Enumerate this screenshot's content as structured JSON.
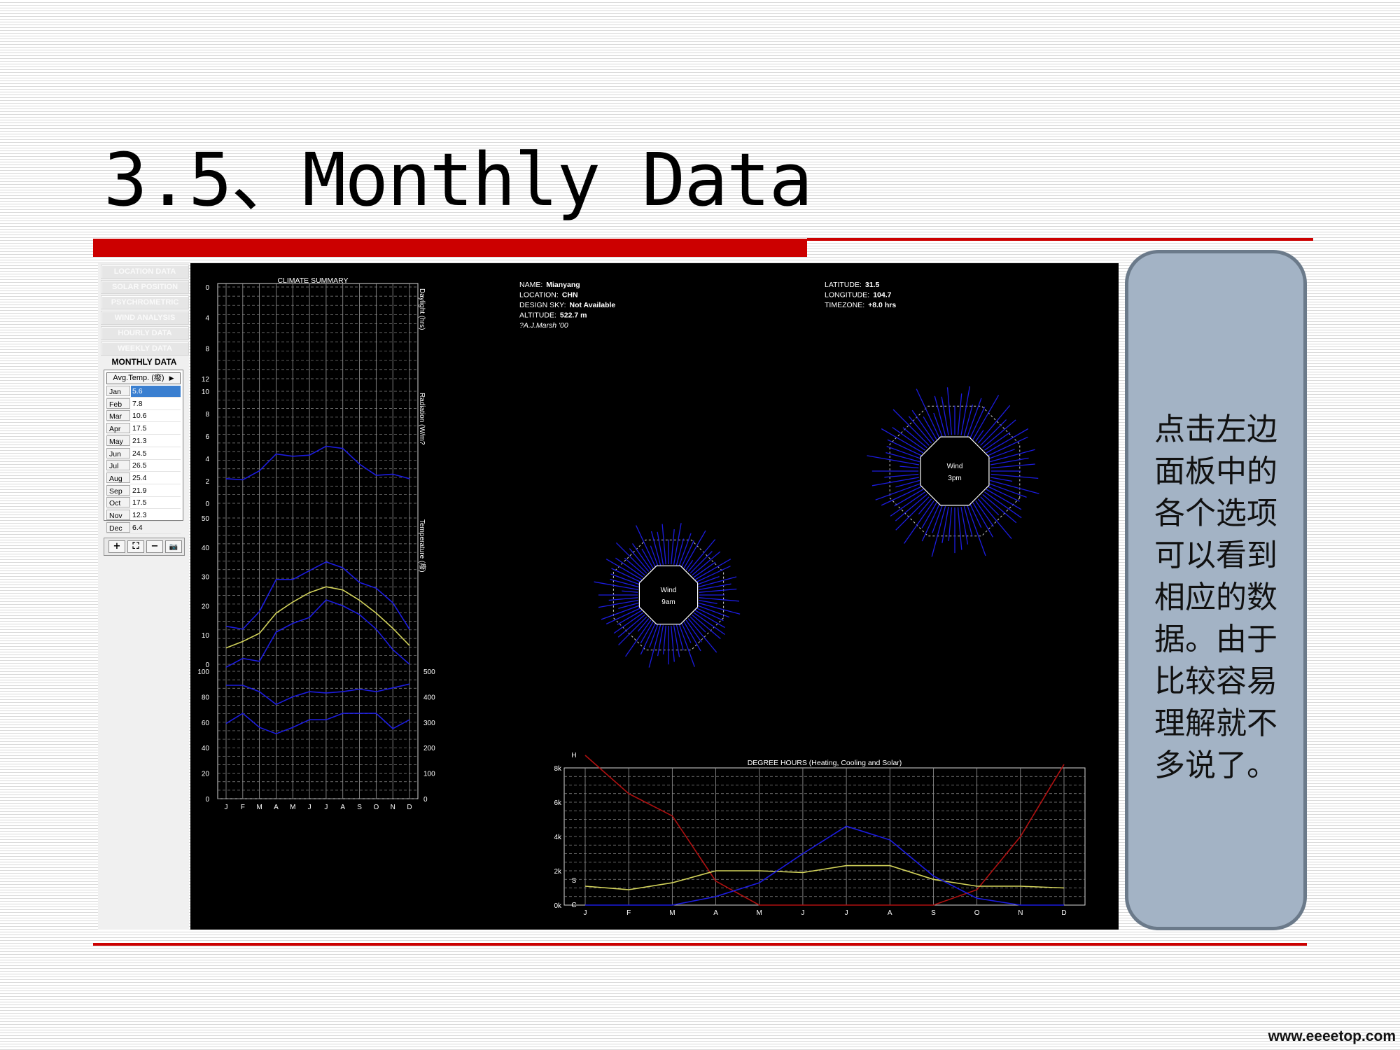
{
  "slide": {
    "title": "3.5、Monthly Data",
    "callout": "点击左边面板中的各个选项可以看到相应的数据。由于比较容易理解就不多说了。",
    "watermark": "www.eeeetop.com"
  },
  "colors": {
    "accent_red": "#cc0000",
    "callout_fill": "#a3b3c5",
    "callout_border": "#6b7a8a",
    "canvas_bg": "#000000",
    "series_blue": "#1c1ce0",
    "series_yellow": "#d2d25a",
    "series_red": "#b01010",
    "selected_row": "#3a7fd0"
  },
  "panel": {
    "menu": [
      "LOCATION DATA",
      "SOLAR POSITION",
      "PSYCHROMETRIC",
      "WIND ANALYSIS",
      "HOURLY DATA",
      "WEEKLY DATA"
    ],
    "heading": "MONTHLY DATA",
    "selector": "Avg.Temp. (癈)",
    "selector_icon": "triangle-right-icon",
    "rows": [
      {
        "month": "Jan",
        "value": "5.6"
      },
      {
        "month": "Feb",
        "value": "7.8"
      },
      {
        "month": "Mar",
        "value": "10.6"
      },
      {
        "month": "Apr",
        "value": "17.5"
      },
      {
        "month": "May",
        "value": "21.3"
      },
      {
        "month": "Jun",
        "value": "24.5"
      },
      {
        "month": "Jul",
        "value": "26.5"
      },
      {
        "month": "Aug",
        "value": "25.4"
      },
      {
        "month": "Sep",
        "value": "21.9"
      },
      {
        "month": "Oct",
        "value": "17.5"
      },
      {
        "month": "Nov",
        "value": "12.3"
      },
      {
        "month": "Dec",
        "value": "6.4"
      }
    ],
    "selected_row": 0,
    "tools": [
      {
        "glyph": "+",
        "icon": "zoom-in-icon"
      },
      {
        "glyph": "⛶",
        "icon": "fit-to-window-icon"
      },
      {
        "glyph": "−",
        "icon": "zoom-out-icon"
      },
      {
        "glyph": "📷",
        "icon": "camera-icon"
      }
    ]
  },
  "info": {
    "left": [
      {
        "label": "NAME:",
        "value": "Mianyang"
      },
      {
        "label": "LOCATION:",
        "value": "CHN"
      },
      {
        "label": "DESIGN SKY:",
        "value": "Not Available"
      },
      {
        "label": "ALTITUDE:",
        "value": "522.7 m"
      }
    ],
    "credit": "?A.J.Marsh '00",
    "right": [
      {
        "label": "LATITUDE:",
        "value": "31.5"
      },
      {
        "label": "LONGITUDE:",
        "value": "104.7"
      },
      {
        "label": "TIMEZONE:",
        "value": "+8.0 hrs"
      }
    ]
  },
  "wind_roses": [
    {
      "name": "wind-rose-9am",
      "line1": "Wind",
      "line2": "9am"
    },
    {
      "name": "wind-rose-3pm",
      "line1": "Wind",
      "line2": "3pm"
    }
  ],
  "chart_data": [
    {
      "type": "line",
      "title": "CLIMATE SUMMARY",
      "categories": [
        "J",
        "F",
        "M",
        "A",
        "M",
        "J",
        "J",
        "A",
        "S",
        "O",
        "N",
        "D"
      ],
      "panels": [
        {
          "id": "daylight",
          "ylabel": "Daylight (hrs)",
          "ylim": [
            0,
            12
          ],
          "yticks": [
            "0",
            "4",
            "8",
            "12"
          ],
          "inverted": true,
          "series": []
        },
        {
          "id": "radiation",
          "ylabel": "Radiation (W/m?",
          "ylim": [
            0,
            10
          ],
          "yticks": [
            "10",
            "8",
            "6",
            "4",
            "2",
            "0"
          ],
          "series": [
            {
              "color": "#1c1ce0",
              "values": [
                2.2,
                2.1,
                2.9,
                4.4,
                4.2,
                4.3,
                5.1,
                4.9,
                3.5,
                2.5,
                2.6,
                2.2
              ]
            }
          ]
        },
        {
          "id": "temperature",
          "ylabel": "Temperature (癈)",
          "ylim": [
            0,
            50
          ],
          "yticks": [
            "50",
            "40",
            "30",
            "20",
            "10",
            "0"
          ],
          "series": [
            {
              "color": "#1c1ce0",
              "values": [
                13,
                12,
                18,
                29,
                29,
                32,
                35,
                33,
                28,
                26,
                21,
                12
              ]
            },
            {
              "color": "#d2d25a",
              "values": [
                5.6,
                7.8,
                10.6,
                17.5,
                21.3,
                24.5,
                26.5,
                25.4,
                21.9,
                17.5,
                12.3,
                6.4
              ]
            },
            {
              "color": "#1c1ce0",
              "values": [
                -1,
                2,
                1,
                11,
                14,
                16,
                22,
                20,
                17,
                12,
                5,
                0
              ]
            }
          ]
        },
        {
          "id": "humidity-rain",
          "ylabel": "",
          "ylim": [
            0,
            100
          ],
          "yticks": [
            "100",
            "80",
            "60",
            "40",
            "20",
            "0"
          ],
          "ylim_right": [
            0,
            500
          ],
          "yticks_right": [
            "500",
            "400",
            "300",
            "200",
            "100",
            "0"
          ],
          "series": [
            {
              "color": "#1c1ce0",
              "values": [
                89,
                89,
                84,
                74,
                80,
                84,
                83,
                84,
                86,
                84,
                87,
                90
              ]
            },
            {
              "color": "#1c1ce0",
              "values": [
                59,
                67,
                56,
                51,
                56,
                62,
                62,
                67,
                67,
                67,
                55,
                62
              ]
            }
          ]
        }
      ]
    },
    {
      "type": "line",
      "title": "DEGREE HOURS (Heating, Cooling and Solar)",
      "categories": [
        "J",
        "F",
        "M",
        "A",
        "M",
        "J",
        "J",
        "A",
        "S",
        "O",
        "N",
        "D"
      ],
      "ylim": [
        0,
        8000
      ],
      "yticks": [
        "0k",
        "2k",
        "4k",
        "6k",
        "8k"
      ],
      "series": [
        {
          "name": "H",
          "color": "#b01010",
          "values": [
            8800,
            6500,
            5200,
            1400,
            0,
            0,
            0,
            0,
            0,
            900,
            4000,
            8200
          ]
        },
        {
          "name": "S",
          "color": "#d2d25a",
          "values": [
            1100,
            900,
            1300,
            2000,
            2000,
            1900,
            2300,
            2300,
            1500,
            1100,
            1100,
            1000
          ]
        },
        {
          "name": "C",
          "color": "#1c1ce0",
          "values": [
            0,
            0,
            0,
            500,
            1300,
            3000,
            4600,
            3800,
            1700,
            400,
            0,
            0
          ]
        }
      ]
    }
  ]
}
